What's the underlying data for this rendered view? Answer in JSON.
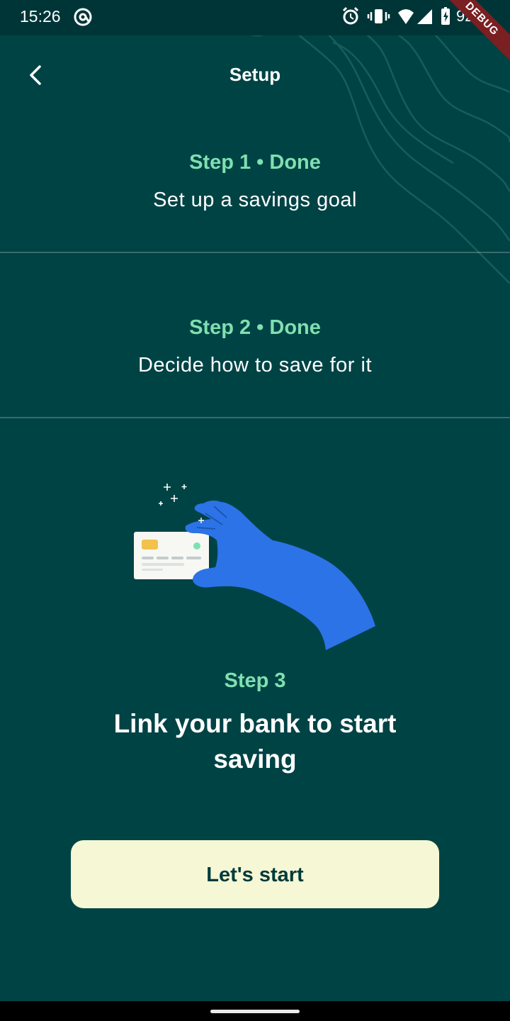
{
  "status_bar": {
    "time": "15:26",
    "battery_percent": "92%",
    "icons": [
      "at-sign-icon",
      "alarm-icon",
      "vibrate-icon",
      "wifi-icon",
      "signal-icon",
      "battery-charging-icon"
    ]
  },
  "debug_banner": "DEBUG",
  "header": {
    "title": "Setup",
    "back_icon": "chevron-left-icon"
  },
  "steps": [
    {
      "status": "Step 1 • Done",
      "description": "Set up a savings goal"
    },
    {
      "status": "Step 2 • Done",
      "description": "Decide how to save for it"
    }
  ],
  "current_step": {
    "label": "Step 3",
    "title": "Link your bank to start saving",
    "illustration": "hand-holding-card-illustration"
  },
  "primary_button": {
    "label": "Let's start"
  },
  "colors": {
    "background": "#004345",
    "accent_green": "#7fe0b0",
    "button_bg": "#f6f7d4",
    "hand_blue": "#2b73e6"
  }
}
